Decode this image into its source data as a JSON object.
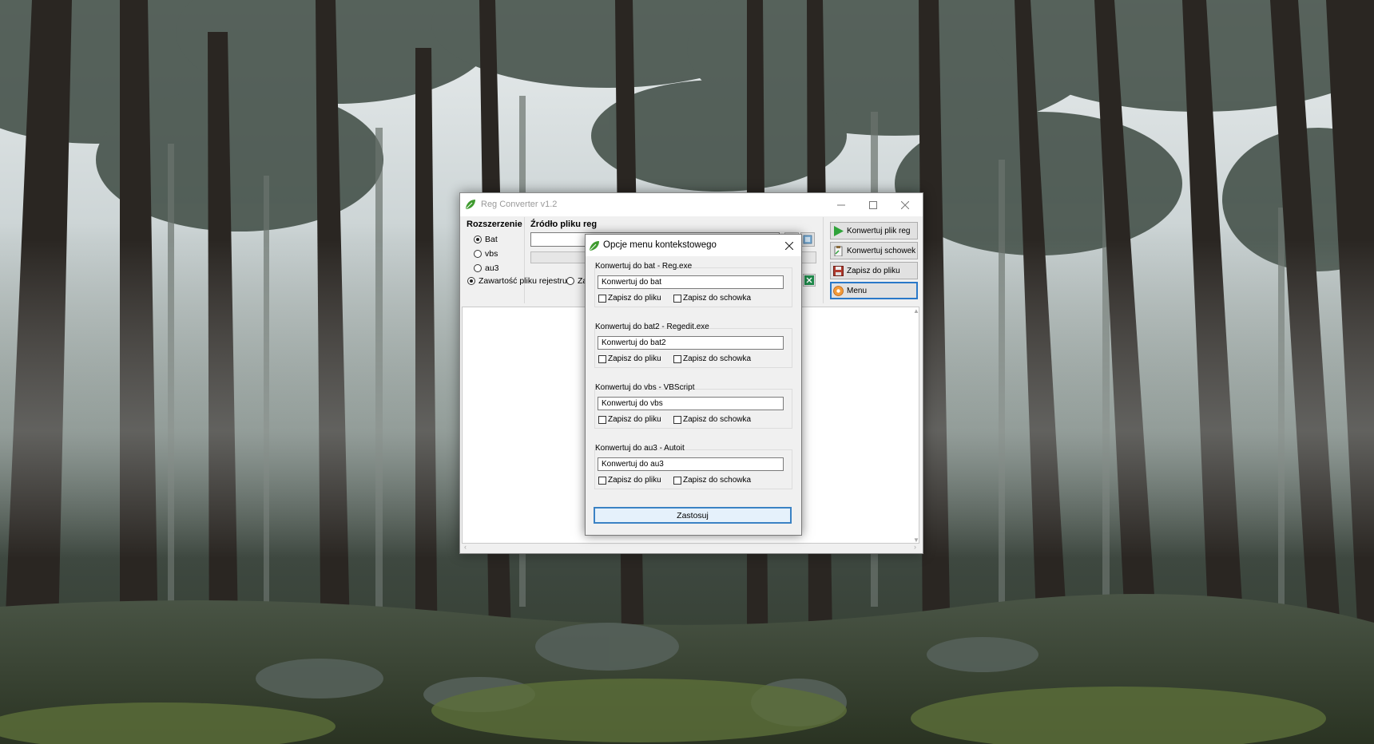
{
  "main_window": {
    "title": "Reg Converter v1.2",
    "extension_label": "Rozszerzenie",
    "extension_options": [
      {
        "label": "Bat",
        "selected": true
      },
      {
        "label": "vbs",
        "selected": false
      },
      {
        "label": "au3",
        "selected": false
      }
    ],
    "source_label": "Źródło pliku reg",
    "source_value": "",
    "content_options": [
      {
        "label": "Zawartość pliku rejestru",
        "selected": true
      },
      {
        "label": "Za",
        "selected": false
      }
    ],
    "side_buttons": [
      {
        "label": "Konwertuj plik reg",
        "icon": "play-icon"
      },
      {
        "label": "Konwertuj schowek",
        "icon": "clipboard-icon"
      },
      {
        "label": "Zapisz do pliku",
        "icon": "floppy-save-icon"
      },
      {
        "label": "Menu",
        "icon": "menu-icon"
      }
    ]
  },
  "dialog": {
    "title": "Opcje menu kontekstowego",
    "groups": [
      {
        "title": "Konwertuj do bat - Reg.exe",
        "value": "Konwertuj do bat",
        "check_file": "Zapisz do pliku",
        "check_clip": "Zapisz do schowka"
      },
      {
        "title": "Konwertuj do bat2 - Regedit.exe",
        "value": "Konwertuj do bat2",
        "check_file": "Zapisz do pliku",
        "check_clip": "Zapisz do schowka"
      },
      {
        "title": "Konwertuj do vbs - VBScript",
        "value": "Konwertuj do vbs",
        "check_file": "Zapisz do pliku",
        "check_clip": "Zapisz do schowka"
      },
      {
        "title": "Konwertuj do au3 - Autoit",
        "value": "Konwertuj do au3",
        "check_file": "Zapisz do pliku",
        "check_clip": "Zapisz do schowka"
      }
    ],
    "apply_label": "Zastosuj"
  },
  "colors": {
    "accent": "#2a78c8",
    "app_icon_green": "#3f9b2f"
  }
}
